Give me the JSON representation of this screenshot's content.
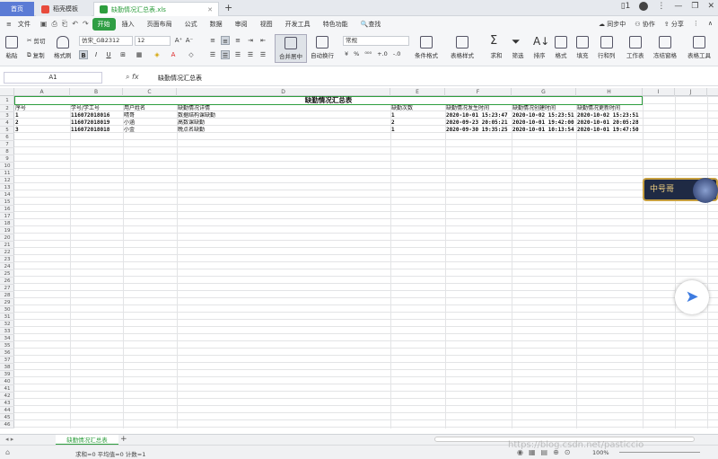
{
  "tabs": {
    "home": "首页",
    "template": "稻壳模板",
    "file": "缺勤情况汇总表.xls"
  },
  "menu": {
    "file": "文件",
    "items": [
      "开始",
      "插入",
      "页面布局",
      "公式",
      "数据",
      "审阅",
      "视图",
      "开发工具",
      "特色功能"
    ],
    "search": "查找",
    "sync": "同步中",
    "collab": "协作",
    "share": "分享"
  },
  "ribbon": {
    "paste": "粘贴",
    "cut": "剪切",
    "copy": "复制",
    "format_painter": "格式刷",
    "font_name": "仿宋_GB2312",
    "font_size": "12",
    "merge": "合并居中",
    "wrap": "自动换行",
    "num_format": "常规",
    "cond_format": "条件格式",
    "table_style": "表格样式",
    "sum": "求和",
    "filter": "筛选",
    "sort": "排序",
    "format": "格式",
    "fill": "填充",
    "rowcol": "行和列",
    "worksheet": "工作表",
    "freeze": "冻结窗格",
    "table_tools": "表格工具"
  },
  "formula": {
    "namebox": "A1",
    "value": "缺勤情况汇总表"
  },
  "columns": [
    "A",
    "B",
    "C",
    "D",
    "E",
    "F",
    "G",
    "H",
    "I",
    "J"
  ],
  "rows": [
    "1",
    "2",
    "3",
    "4",
    "5",
    "6",
    "7",
    "8",
    "9",
    "10",
    "11",
    "12",
    "13",
    "14",
    "15",
    "16",
    "17",
    "18",
    "19",
    "20",
    "21",
    "22",
    "23",
    "24",
    "25",
    "26",
    "27",
    "28",
    "29",
    "30",
    "31",
    "32",
    "33",
    "34",
    "35",
    "36",
    "37",
    "38",
    "39",
    "40",
    "41",
    "42",
    "43",
    "44",
    "45",
    "46"
  ],
  "sheet": {
    "title": "缺勤情况汇总表",
    "headers": [
      "序号",
      "学号/学工号",
      "用户姓名",
      "缺勤情况详情",
      "缺勤次数",
      "缺勤情况发生时间",
      "缺勤情况创建时间",
      "缺勤情况更新时间"
    ],
    "data": [
      [
        "1",
        "116072018016",
        "晴哥",
        "数据结构课缺勤",
        "1",
        "2020-10-01 15:23:47",
        "2020-10-02 15:23:51",
        "2020-10-02 15:23:51"
      ],
      [
        "2",
        "116072018019",
        "小涵",
        "高数课缺勤",
        "2",
        "2020-09-23 20:05:21",
        "2020-10-01 19:42:00",
        "2020-10-01 20:05:28"
      ],
      [
        "3",
        "116072018018",
        "小金",
        "晚点名缺勤",
        "1",
        "2020-09-30 19:35:25",
        "2020-10-01 10:13:54",
        "2020-10-01 19:47:50"
      ]
    ]
  },
  "sheet_tab": "缺勤情况汇总表",
  "status": {
    "text": "求和=0  平均值=0  计数=1",
    "zoom": "100%"
  },
  "widget": {
    "game_text": "中号哥"
  },
  "watermark": "https://blog.csdn.net/pasticcio"
}
